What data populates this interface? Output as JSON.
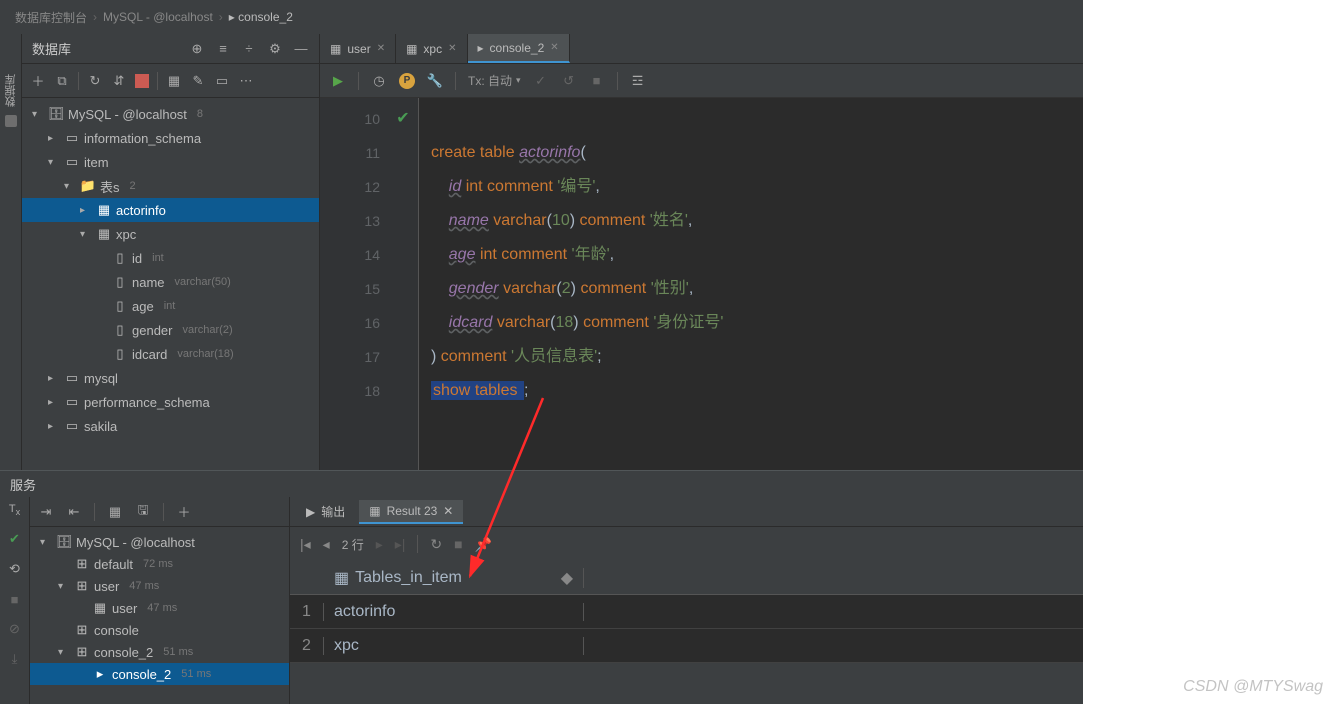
{
  "breadcrumb": {
    "a": "数据库控制台",
    "b": "MySQL - @localhost",
    "c": "console_2"
  },
  "db_panel": {
    "title": "数据库",
    "tree": [
      {
        "d": 0,
        "exp": "v",
        "ico": "db",
        "label": "MySQL - @localhost",
        "dim": "8"
      },
      {
        "d": 1,
        "exp": ">",
        "ico": "sch",
        "label": "information_schema"
      },
      {
        "d": 1,
        "exp": "v",
        "ico": "sch",
        "label": "item"
      },
      {
        "d": 2,
        "exp": "v",
        "ico": "fld",
        "label": "表s",
        "dim": "2"
      },
      {
        "d": 3,
        "exp": ">",
        "ico": "tbl",
        "label": "actorinfo",
        "sel": true
      },
      {
        "d": 3,
        "exp": "v",
        "ico": "tbl",
        "label": "xpc"
      },
      {
        "d": 4,
        "exp": "",
        "ico": "col",
        "label": "id",
        "dim": "int"
      },
      {
        "d": 4,
        "exp": "",
        "ico": "col",
        "label": "name",
        "dim": "varchar(50)"
      },
      {
        "d": 4,
        "exp": "",
        "ico": "col",
        "label": "age",
        "dim": "int"
      },
      {
        "d": 4,
        "exp": "",
        "ico": "col",
        "label": "gender",
        "dim": "varchar(2)"
      },
      {
        "d": 4,
        "exp": "",
        "ico": "col",
        "label": "idcard",
        "dim": "varchar(18)"
      },
      {
        "d": 1,
        "exp": ">",
        "ico": "sch",
        "label": "mysql"
      },
      {
        "d": 1,
        "exp": ">",
        "ico": "sch",
        "label": "performance_schema"
      },
      {
        "d": 1,
        "exp": ">",
        "ico": "sch",
        "label": "sakila"
      }
    ]
  },
  "tabs": [
    {
      "ico": "tbl",
      "label": "user",
      "active": false
    },
    {
      "ico": "tbl",
      "label": "xpc",
      "active": false
    },
    {
      "ico": "con",
      "label": "console_2",
      "active": true
    }
  ],
  "toolbar": {
    "tx_label": "Tx: 自动"
  },
  "editor": {
    "start": 10,
    "lines": [
      {
        "n": 10,
        "html": ""
      },
      {
        "n": 11,
        "html": "<span class='kw'>create</span> <span class='kw'>table</span> <span class='ident'>actorinfo</span><span class='punc'>(</span>"
      },
      {
        "n": 12,
        "html": "    <span class='ident'>id</span> <span class='typ'>int</span> <span class='kw'>comment</span> <span class='str'>'编号'</span><span class='punc'>,</span>"
      },
      {
        "n": 13,
        "html": "    <span class='ident'>name</span> <span class='typ'>varchar</span><span class='punc'>(</span><span class='str'>10</span><span class='punc'>)</span> <span class='kw'>comment</span> <span class='str'>'姓名'</span><span class='punc'>,</span>"
      },
      {
        "n": 14,
        "html": "    <span class='ident'>age</span> <span class='typ'>int</span> <span class='kw'>comment</span> <span class='str'>'年龄'</span><span class='punc'>,</span>"
      },
      {
        "n": 15,
        "html": "    <span class='ident'>gender</span> <span class='typ'>varchar</span><span class='punc'>(</span><span class='str'>2</span><span class='punc'>)</span> <span class='kw'>comment</span> <span class='str'>'性别'</span><span class='punc'>,</span>"
      },
      {
        "n": 16,
        "html": "    <span class='ident'>idcard</span> <span class='typ'>varchar</span><span class='punc'>(</span><span class='str'>18</span><span class='punc'>)</span> <span class='kw'>comment</span> <span class='str'>'身份证号'</span>"
      },
      {
        "n": 17,
        "html": "<span class='punc'>)</span> <span class='kw'>comment</span> <span class='str'>'人员信息表'</span><span class='punc'>;</span>"
      },
      {
        "n": 18,
        "html": "<span class='sel-stmt'><span class='kw'>show</span> <span class='kw'>tables</span> </span><span class='punc'>;</span>",
        "chk": true
      }
    ]
  },
  "services": {
    "title": "服务",
    "tree": [
      {
        "d": 0,
        "exp": "v",
        "ico": "db",
        "label": "MySQL - @localhost"
      },
      {
        "d": 1,
        "exp": "",
        "ico": "ds",
        "label": "default",
        "dim": "72 ms"
      },
      {
        "d": 1,
        "exp": "v",
        "ico": "ds",
        "label": "user",
        "dim": "47 ms"
      },
      {
        "d": 2,
        "exp": "",
        "ico": "tbl",
        "label": "user",
        "dim": "47 ms"
      },
      {
        "d": 1,
        "exp": "",
        "ico": "ds",
        "label": "console"
      },
      {
        "d": 1,
        "exp": "v",
        "ico": "ds",
        "label": "console_2",
        "dim": "51 ms"
      },
      {
        "d": 2,
        "exp": "",
        "ico": "con",
        "label": "console_2",
        "dim": "51 ms",
        "sel": true
      }
    ]
  },
  "result": {
    "tabs": [
      {
        "ico": "out",
        "label": "输出"
      },
      {
        "ico": "tbl",
        "label": "Result 23",
        "active": true
      }
    ],
    "rows_label": "2 行",
    "header": "Tables_in_item",
    "rows": [
      {
        "n": 1,
        "v": "actorinfo"
      },
      {
        "n": 2,
        "v": "xpc"
      }
    ]
  },
  "watermark": "CSDN @MTYSwag"
}
